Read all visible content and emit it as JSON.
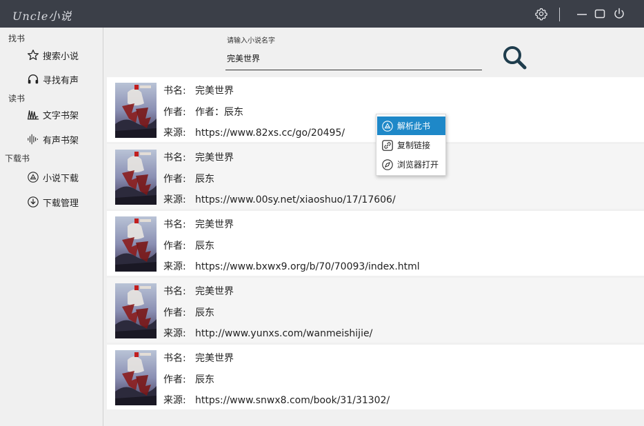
{
  "app": {
    "title": "Uncle小说"
  },
  "titlebar": {
    "icons": [
      "settings-icon",
      "minimize-icon",
      "maximize-icon",
      "power-icon"
    ]
  },
  "sidebar": {
    "sections": [
      {
        "title": "找书",
        "items": [
          {
            "label": "搜索小说",
            "icon": "star-icon"
          },
          {
            "label": "寻找有声",
            "icon": "headphones-icon"
          }
        ]
      },
      {
        "title": "读书",
        "items": [
          {
            "label": "文字书架",
            "icon": "books-icon"
          },
          {
            "label": "有声书架",
            "icon": "sound-wave-icon"
          }
        ]
      },
      {
        "title": "下载书",
        "items": [
          {
            "label": "小说下载",
            "icon": "parse-icon"
          },
          {
            "label": "下载管理",
            "icon": "download-icon"
          }
        ]
      }
    ]
  },
  "search": {
    "label": "请输入小说名字",
    "value": "完美世界"
  },
  "labels": {
    "name": "书名:",
    "author": "作者:",
    "source": "来源:"
  },
  "results": [
    {
      "name": "完美世界",
      "author": "作者：辰东",
      "source": "https://www.82xs.cc/go/20495/"
    },
    {
      "name": "完美世界",
      "author": "辰东",
      "source": "https://www.00sy.net/xiaoshuo/17/17606/"
    },
    {
      "name": "完美世界",
      "author": "辰东",
      "source": "https://www.bxwx9.org/b/70/70093/index.html"
    },
    {
      "name": "完美世界",
      "author": "辰东",
      "source": "http://www.yunxs.com/wanmeishijie/"
    },
    {
      "name": "完美世界",
      "author": "辰东",
      "source": "https://www.snwx8.com/book/31/31302/"
    }
  ],
  "context_menu": {
    "items": [
      {
        "label": "解析此书",
        "icon": "parse-icon",
        "highlighted": true
      },
      {
        "label": "复制链接",
        "icon": "link-icon",
        "highlighted": false
      },
      {
        "label": "浏览器打开",
        "icon": "compass-icon",
        "highlighted": false
      }
    ]
  },
  "colors": {
    "titlebar": "#3b3f48",
    "highlight": "#1e88c8",
    "search_icon": "#1f3d4d"
  }
}
